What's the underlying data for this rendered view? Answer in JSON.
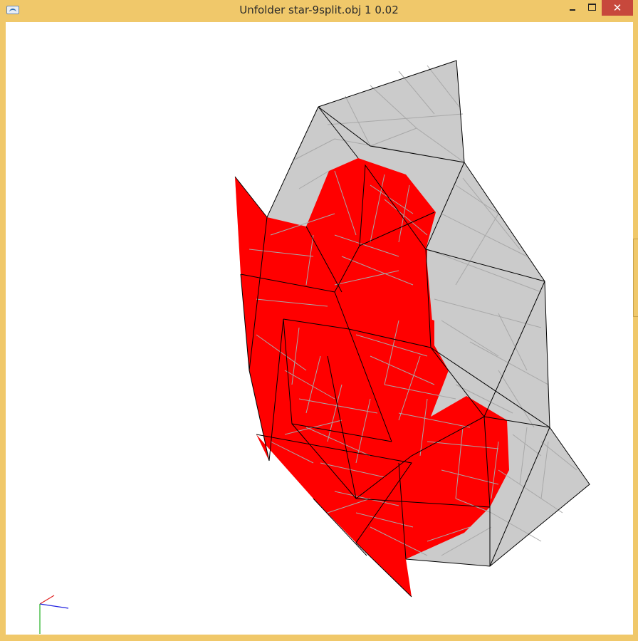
{
  "window": {
    "title": "Unfolder star-9split.obj 1 0.02",
    "controls": {
      "minimize": "minimize-icon",
      "maximize": "maximize-icon",
      "close": "close-icon"
    }
  },
  "colors": {
    "titlebar": "#f0c86a",
    "face_gray": "#cbcbcb",
    "face_red": "#ff0000",
    "edge_dark": "#000000",
    "edge_light": "#9a9a9a",
    "close_button": "#c7483c",
    "axis_x": "#e02020",
    "axis_y": "#20b020",
    "axis_z": "#2020e0"
  }
}
